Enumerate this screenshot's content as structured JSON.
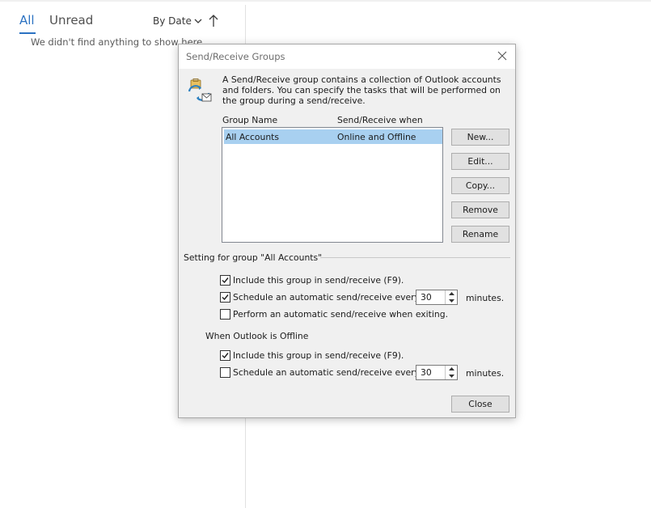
{
  "list_header": {
    "tab_all": "All",
    "tab_unread": "Unread",
    "sort_label": "By Date",
    "empty_message": "We didn't find anything to show here."
  },
  "dialog": {
    "title": "Send/Receive Groups",
    "intro": "A Send/Receive group contains a collection of Outlook accounts and folders. You can specify the tasks that will be performed on the group during a send/receive.",
    "columns": {
      "group_name": "Group Name",
      "when": "Send/Receive when"
    },
    "groups": [
      {
        "name": "All Accounts",
        "when": "Online and Offline",
        "selected": true
      }
    ],
    "buttons": {
      "new": "New...",
      "edit": "Edit...",
      "copy": "Copy...",
      "remove": "Remove",
      "rename": "Rename",
      "close": "Close"
    },
    "group_settings_label": "Setting for group \"All Accounts\"",
    "online": {
      "include_label": "Include this group in send/receive (F9).",
      "include_checked": true,
      "schedule_label": "Schedule an automatic send/receive every",
      "schedule_checked": true,
      "schedule_minutes": "30",
      "minutes_label": "minutes.",
      "exit_label": "Perform an automatic send/receive when exiting.",
      "exit_checked": false
    },
    "offline_label": "When Outlook is Offline",
    "offline": {
      "include_label": "Include this group in send/receive (F9).",
      "include_checked": true,
      "schedule_label": "Schedule an automatic send/receive every",
      "schedule_checked": false,
      "schedule_minutes": "30",
      "minutes_label": "minutes."
    }
  },
  "colors": {
    "accent": "#2b72c2",
    "selection": "#a8d0f0",
    "dialog_bg": "#f0f0f0"
  }
}
